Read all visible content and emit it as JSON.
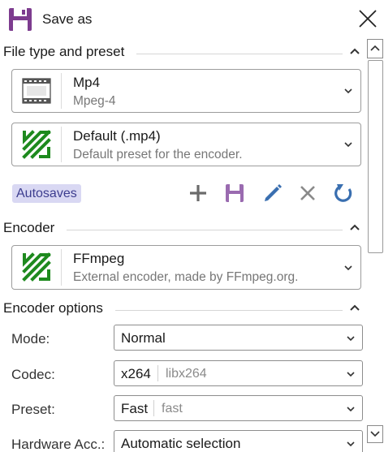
{
  "window": {
    "title": "Save as",
    "icons": {
      "app": "floppy-disk-icon",
      "close": "close-icon"
    },
    "accent": "#7d3c8f"
  },
  "file_type_section": {
    "title": "File type and preset",
    "format": {
      "name": "Mp4",
      "description": "Mpeg-4",
      "icon": "film-strip-icon"
    },
    "preset": {
      "name": "Default (.mp4)",
      "description": "Default preset for the encoder.",
      "icon": "ffmpeg-logo-icon"
    },
    "autosaves_label": "Autosaves",
    "toolbar_icons": [
      "add-icon",
      "save-icon",
      "edit-icon",
      "delete-icon",
      "reset-icon"
    ],
    "colors": {
      "ffmpeg_green": "#1e8a1e",
      "toolbar_blue": "#3a6fb0",
      "toolbar_gray": "#6b6b6b",
      "save_purple": "#9a6bb0",
      "autosaves_bg": "#d9d8f3"
    }
  },
  "encoder_section": {
    "title": "Encoder",
    "encoder": {
      "name": "FFmpeg",
      "description": "External encoder, made by FFmpeg.org.",
      "icon": "ffmpeg-logo-icon"
    }
  },
  "encoder_options_section": {
    "title": "Encoder options",
    "options": [
      {
        "label": "Mode:",
        "value": "Normal",
        "extra": ""
      },
      {
        "label": "Codec:",
        "value": "x264",
        "extra": "libx264"
      },
      {
        "label": "Preset:",
        "value": "Fast",
        "extra": "fast"
      },
      {
        "label": "Hardware Acc.:",
        "value": "Automatic selection",
        "extra": ""
      }
    ]
  }
}
